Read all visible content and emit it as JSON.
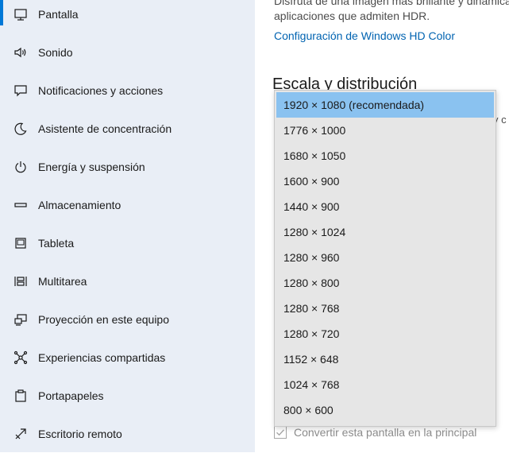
{
  "colors": {
    "sidebar_bg": "#e9eef6",
    "accent": "#0078d7",
    "link": "#0063b1",
    "dropdown_bg": "#e6e6e6",
    "dropdown_selected": "#8ac2f0"
  },
  "sidebar": {
    "items": [
      {
        "label": "Pantalla",
        "icon": "monitor-icon",
        "selected": true
      },
      {
        "label": "Sonido",
        "icon": "speaker-icon"
      },
      {
        "label": "Notificaciones y acciones",
        "icon": "message-icon"
      },
      {
        "label": "Asistente de concentración",
        "icon": "moon-icon"
      },
      {
        "label": "Energía y suspensión",
        "icon": "power-icon"
      },
      {
        "label": "Almacenamiento",
        "icon": "storage-icon"
      },
      {
        "label": "Tableta",
        "icon": "tablet-icon"
      },
      {
        "label": "Multitarea",
        "icon": "multitask-icon"
      },
      {
        "label": "Proyección en este equipo",
        "icon": "projection-icon"
      },
      {
        "label": "Experiencias compartidas",
        "icon": "share-icon"
      },
      {
        "label": "Portapapeles",
        "icon": "clipboard-icon"
      },
      {
        "label": "Escritorio remoto",
        "icon": "remote-icon"
      }
    ]
  },
  "main": {
    "hdr_desc_line1": "Disfruta de una imagen más brillante y dinámica",
    "hdr_desc_line2": "aplicaciones que admiten HDR.",
    "hdr_link": "Configuración de Windows HD Color",
    "section_title": "Escala y distribución",
    "right_fragment": "y c",
    "checkbox_label": "Convertir esta pantalla en la principal",
    "checkbox_checked": true
  },
  "dropdown": {
    "selected_index": 0,
    "options": [
      "1920 × 1080 (recomendada)",
      "1776 × 1000",
      "1680 × 1050",
      "1600 × 900",
      "1440 × 900",
      "1280 × 1024",
      "1280 × 960",
      "1280 × 800",
      "1280 × 768",
      "1280 × 720",
      "1152 × 648",
      "1024 × 768",
      "800 × 600"
    ]
  }
}
